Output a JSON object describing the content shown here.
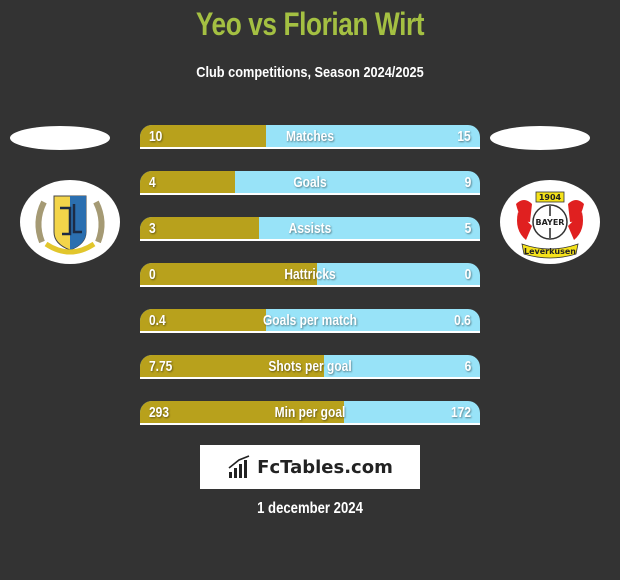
{
  "header": {
    "title": "Yeo vs Florian Wirt",
    "subtitle": "Club competitions, Season 2024/2025"
  },
  "players": {
    "left": {
      "name": "Yeo",
      "club_logo": "crest-icon"
    },
    "right": {
      "name": "Florian Wirt",
      "club_logo": "bayer-leverkusen-crest-icon",
      "logo_text": {
        "year": "1904",
        "brand": "BAYER",
        "city": "Leverkusen"
      }
    }
  },
  "colors": {
    "left_bar": "#b8a11c",
    "right_bar": "#98e3f8",
    "title": "#a4c042",
    "background": "#333333"
  },
  "stats": [
    {
      "label": "Matches",
      "left": "10",
      "right": "15",
      "left_share": 0.37
    },
    {
      "label": "Goals",
      "left": "4",
      "right": "9",
      "left_share": 0.28
    },
    {
      "label": "Assists",
      "left": "3",
      "right": "5",
      "left_share": 0.35
    },
    {
      "label": "Hattricks",
      "left": "0",
      "right": "0",
      "left_share": 0.52
    },
    {
      "label": "Goals per match",
      "left": "0.4",
      "right": "0.6",
      "left_share": 0.37
    },
    {
      "label": "Shots per goal",
      "left": "7.75",
      "right": "6",
      "left_share": 0.54
    },
    {
      "label": "Min per goal",
      "left": "293",
      "right": "172",
      "left_share": 0.6
    }
  ],
  "brand": {
    "name": "FcTables.com",
    "icon": "bar-chart-icon"
  },
  "footer": {
    "date": "1 december 2024"
  }
}
